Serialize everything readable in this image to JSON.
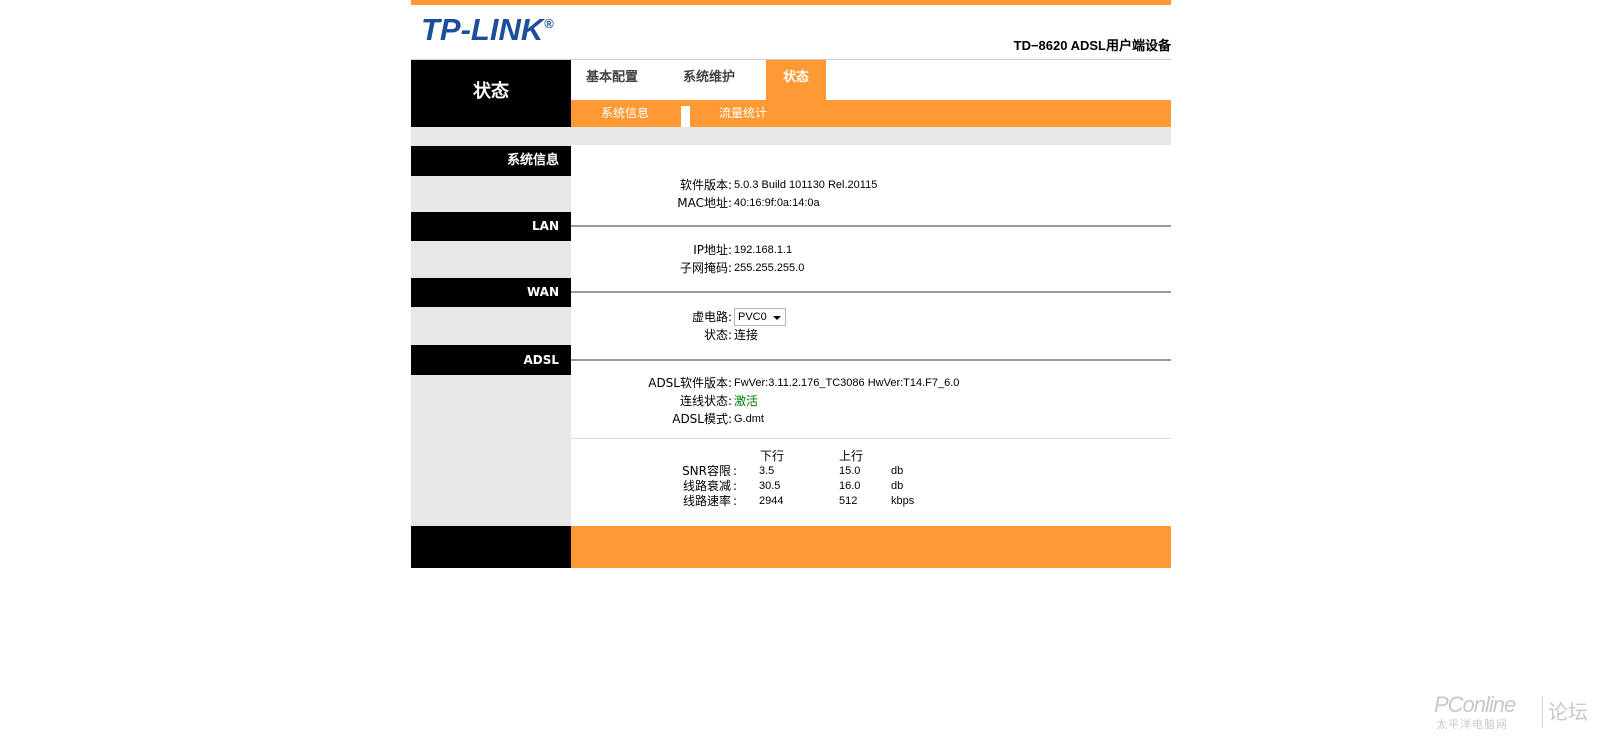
{
  "header": {
    "logo_text": "TP-LINK",
    "logo_mark": "®",
    "model_title": "TD−8620 ADSL用户端设备"
  },
  "nav": {
    "section_title": "状态",
    "tabs": [
      {
        "label": "基本配置"
      },
      {
        "label": "系统维护"
      },
      {
        "label": "状态",
        "active": true
      }
    ],
    "subtabs": [
      {
        "label": "系统信息",
        "active": true
      },
      {
        "label": "流量统计"
      }
    ]
  },
  "sections": {
    "sysinfo": {
      "title": "系统信息",
      "rows": [
        {
          "label": "软件版本",
          "value": "5.0.3 Build 101130 Rel.20115"
        },
        {
          "label": "MAC地址",
          "value": "40:16:9f:0a:14:0a"
        }
      ]
    },
    "lan": {
      "title": "LAN",
      "rows": [
        {
          "label": "IP地址",
          "value": "192.168.1.1"
        },
        {
          "label": "子网掩码",
          "value": "255.255.255.0"
        }
      ]
    },
    "wan": {
      "title": "WAN",
      "vc_label": "虚电路",
      "vc_selected": "PVC0",
      "state_label": "状态",
      "state_value": "连接"
    },
    "adsl": {
      "title": "ADSL",
      "rows": [
        {
          "label": "ADSL软件版本",
          "value": "FwVer:3.11.2.176_TC3086 HwVer:T14.F7_6.0"
        },
        {
          "label": "连线状态",
          "value": "激活"
        },
        {
          "label": "ADSL模式",
          "value": "G.dmt"
        }
      ],
      "stats": {
        "col_down": "下行",
        "col_up": "上行",
        "rows": [
          {
            "label": "SNR容限",
            "down": "3.5",
            "up": "15.0",
            "unit": "db"
          },
          {
            "label": "线路衰减",
            "down": "30.5",
            "up": "16.0",
            "unit": "db"
          },
          {
            "label": "线路速率",
            "down": "2944",
            "up": "512",
            "unit": "kbps"
          }
        ]
      }
    }
  },
  "colors": {
    "accent": "#ff9933",
    "brand_blue": "#1b4f9c",
    "active_green": "#008000"
  },
  "watermark": {
    "brand": "PConline",
    "sub": "太平洋电脑网",
    "forum": "论坛"
  }
}
